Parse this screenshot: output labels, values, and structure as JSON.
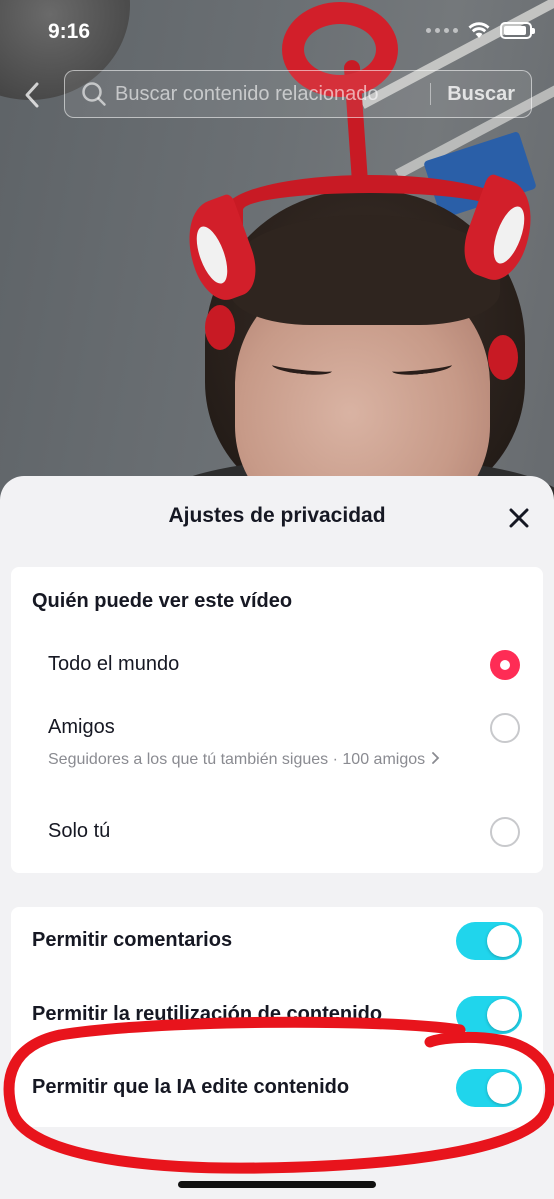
{
  "status_bar": {
    "time": "9:16",
    "battery_level": 0.9
  },
  "search": {
    "placeholder": "Buscar contenido relacionado",
    "button_label": "Buscar"
  },
  "sheet": {
    "title": "Ajustes de privacidad",
    "visibility": {
      "title": "Quién puede ver este vídeo",
      "options": [
        {
          "label": "Todo el mundo",
          "selected": true
        },
        {
          "label": "Amigos",
          "subtitle": "Seguidores a los que tú también sigues · 100 amigos",
          "selected": false
        },
        {
          "label": "Solo tú",
          "selected": false
        }
      ]
    },
    "toggles": [
      {
        "label": "Permitir comentarios",
        "on": true
      },
      {
        "label": "Permitir la reutilización de contenido",
        "on": true
      },
      {
        "label": "Permitir que la IA edite contenido",
        "on": true
      }
    ]
  },
  "colors": {
    "accent_radio": "#fe2c55",
    "toggle_on": "#20d5ec",
    "annotation": "#e8141c"
  },
  "icons": [
    "back-chevron-icon",
    "search-icon",
    "close-icon",
    "wifi-icon",
    "battery-icon",
    "chevron-right-icon"
  ]
}
